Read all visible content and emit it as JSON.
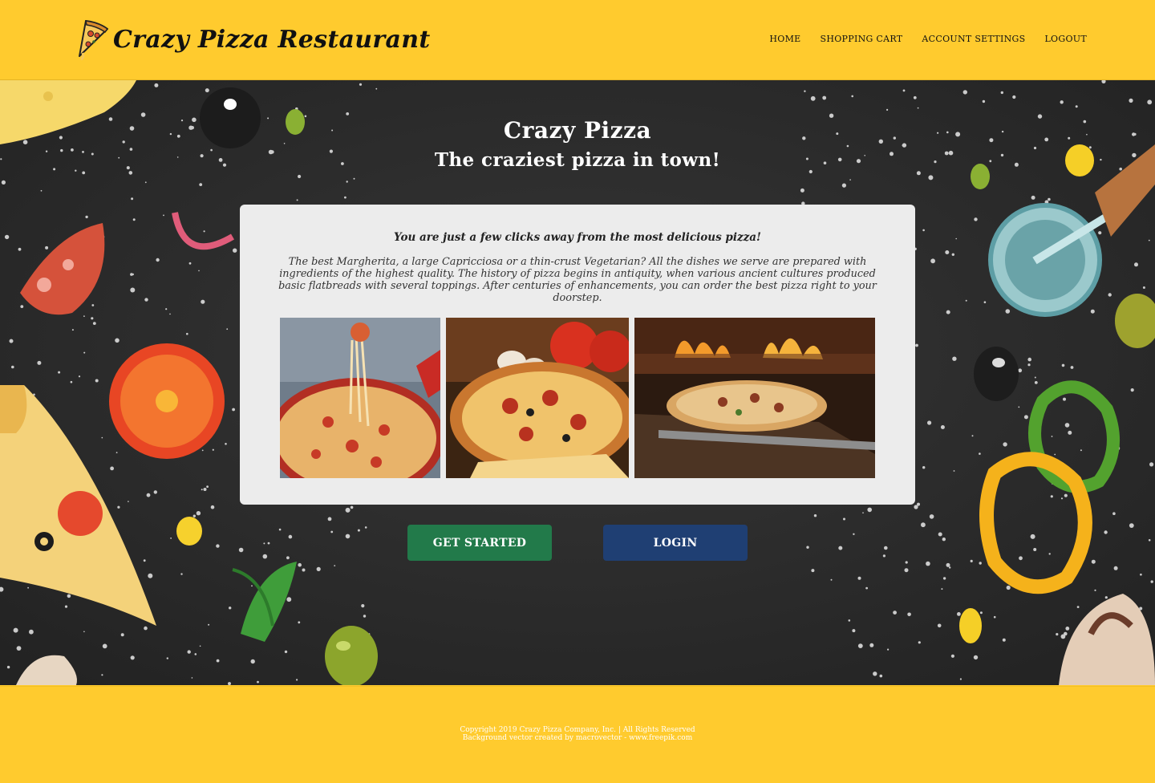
{
  "header": {
    "brand_title": "Crazy Pizza Restaurant",
    "nav": [
      "HOME",
      "SHOPPING CART",
      "ACCOUNT SETTINGS",
      "LOGOUT"
    ]
  },
  "hero": {
    "title": "Crazy Pizza",
    "subtitle": "The craziest pizza in town!"
  },
  "card": {
    "lead": "You are just a few clicks away from the most delicious pizza!",
    "body": "The best Margherita, a large Capricciosa or a thin-crust Vegetarian? All the dishes we serve are prepared with ingredients of the highest quality. The history of pizza begins in antiquity, when various ancient cultures produced basic flatbreads with several toppings. After centuries of enhancements, you can order the best pizza right to your doorstep."
  },
  "buttons": {
    "get_started": "GET STARTED",
    "login": "LOGIN"
  },
  "footer": {
    "copyright": "Copyright 2019 Crazy Pizza Company, Inc. | All Rights Reserved",
    "credit": "Background vector created by macrovector - www.freepik.com"
  },
  "colors": {
    "brand_yellow": "#ffcb2e",
    "get_started_green": "#227a4a",
    "login_blue": "#1f3f73",
    "hero_dark": "#2a2a2a",
    "card_grey": "#ececec"
  }
}
